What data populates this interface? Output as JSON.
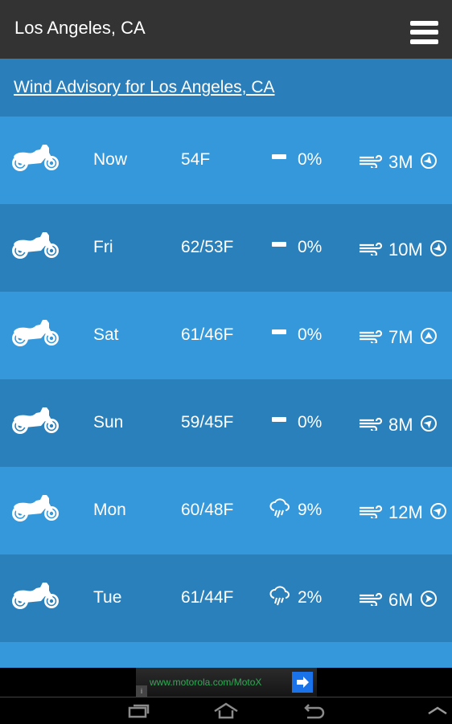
{
  "appbar": {
    "title": "Los Angeles, CA",
    "menu_icon": "hamburger-menu-icon"
  },
  "advisory": {
    "label": "Wind Advisory for Los Angeles, CA"
  },
  "colors": {
    "appbar": "#333333",
    "row_light": "#3498db",
    "row_dark": "#2a80ba",
    "ad_url": "#2eaa55",
    "ad_button": "#1a73e8"
  },
  "forecast": [
    {
      "icon": "motorcycle-icon",
      "day": "Now",
      "temp": "54F",
      "precip_icon": "dash-icon",
      "precip": "0%",
      "wind": "3M",
      "wind_direction": "SE"
    },
    {
      "icon": "motorcycle-icon",
      "day": "Fri",
      "temp": "62/53F",
      "precip_icon": "dash-icon",
      "precip": "0%",
      "wind": "10M",
      "wind_direction": "SE"
    },
    {
      "icon": "motorcycle-icon",
      "day": "Sat",
      "temp": "61/46F",
      "precip_icon": "dash-icon",
      "precip": "0%",
      "wind": "7M",
      "wind_direction": "N"
    },
    {
      "icon": "motorcycle-icon",
      "day": "Sun",
      "temp": "59/45F",
      "precip_icon": "dash-icon",
      "precip": "0%",
      "wind": "8M",
      "wind_direction": "NE"
    },
    {
      "icon": "motorcycle-icon",
      "day": "Mon",
      "temp": "60/48F",
      "precip_icon": "rain-cloud-icon",
      "precip": "9%",
      "wind": "12M",
      "wind_direction": "NE"
    },
    {
      "icon": "motorcycle-icon",
      "day": "Tue",
      "temp": "61/44F",
      "precip_icon": "rain-cloud-icon",
      "precip": "2%",
      "wind": "6M",
      "wind_direction": "E"
    }
  ],
  "ad": {
    "url": "www.motorola.com/MotoX",
    "info_label": "i"
  },
  "navbar": {
    "buttons": [
      "recent-apps",
      "home",
      "back",
      "up"
    ]
  }
}
